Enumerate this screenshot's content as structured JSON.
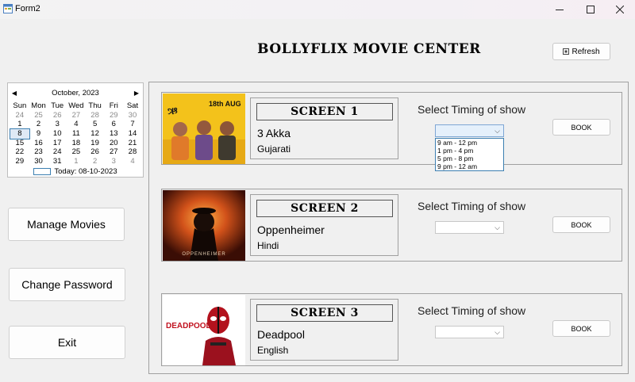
{
  "window": {
    "title": "Form2",
    "controls": [
      "minimize-icon",
      "maximize-icon",
      "close-icon"
    ]
  },
  "heading": "BOLLYFLIX MOVIE CENTER",
  "refresh_label": "Refresh",
  "calendar": {
    "month_label": "October, 2023",
    "weekdays": [
      "Sun",
      "Mon",
      "Tue",
      "Wed",
      "Thu",
      "Fri",
      "Sat"
    ],
    "weeks": [
      [
        "24",
        "25",
        "26",
        "27",
        "28",
        "29",
        "30"
      ],
      [
        "1",
        "2",
        "3",
        "4",
        "5",
        "6",
        "7"
      ],
      [
        "8",
        "9",
        "10",
        "11",
        "12",
        "13",
        "14"
      ],
      [
        "15",
        "16",
        "17",
        "18",
        "19",
        "20",
        "21"
      ],
      [
        "22",
        "23",
        "24",
        "25",
        "26",
        "27",
        "28"
      ],
      [
        "29",
        "30",
        "31",
        "1",
        "2",
        "3",
        "4"
      ]
    ],
    "selected": "8",
    "today_label": "Today: 08-10-2023"
  },
  "sidebar": {
    "manage_movies": "Manage Movies",
    "change_password": "Change Password",
    "exit": "Exit"
  },
  "timing_label": "Select Timing of show",
  "timing_options": [
    "9 am - 12 pm",
    "1 pm - 4 pm",
    "5 pm - 8 pm",
    "9 pm - 12 am"
  ],
  "book_label": "BOOK",
  "screens": [
    {
      "label": "SCREEN 1",
      "movie": "3 Akka",
      "language": "Gujarati",
      "poster_text": "18th AUG"
    },
    {
      "label": "SCREEN 2",
      "movie": "Oppenheimer",
      "language": "Hindi",
      "poster_text": "OPPENHEIMER"
    },
    {
      "label": "SCREEN 3",
      "movie": "Deadpool",
      "language": "English",
      "poster_text": "DEADPOOL"
    }
  ],
  "colors": {
    "accent": "#3c7fb1",
    "poster1_bg": "#f3c21b",
    "poster2_bg": "#c2410c"
  }
}
